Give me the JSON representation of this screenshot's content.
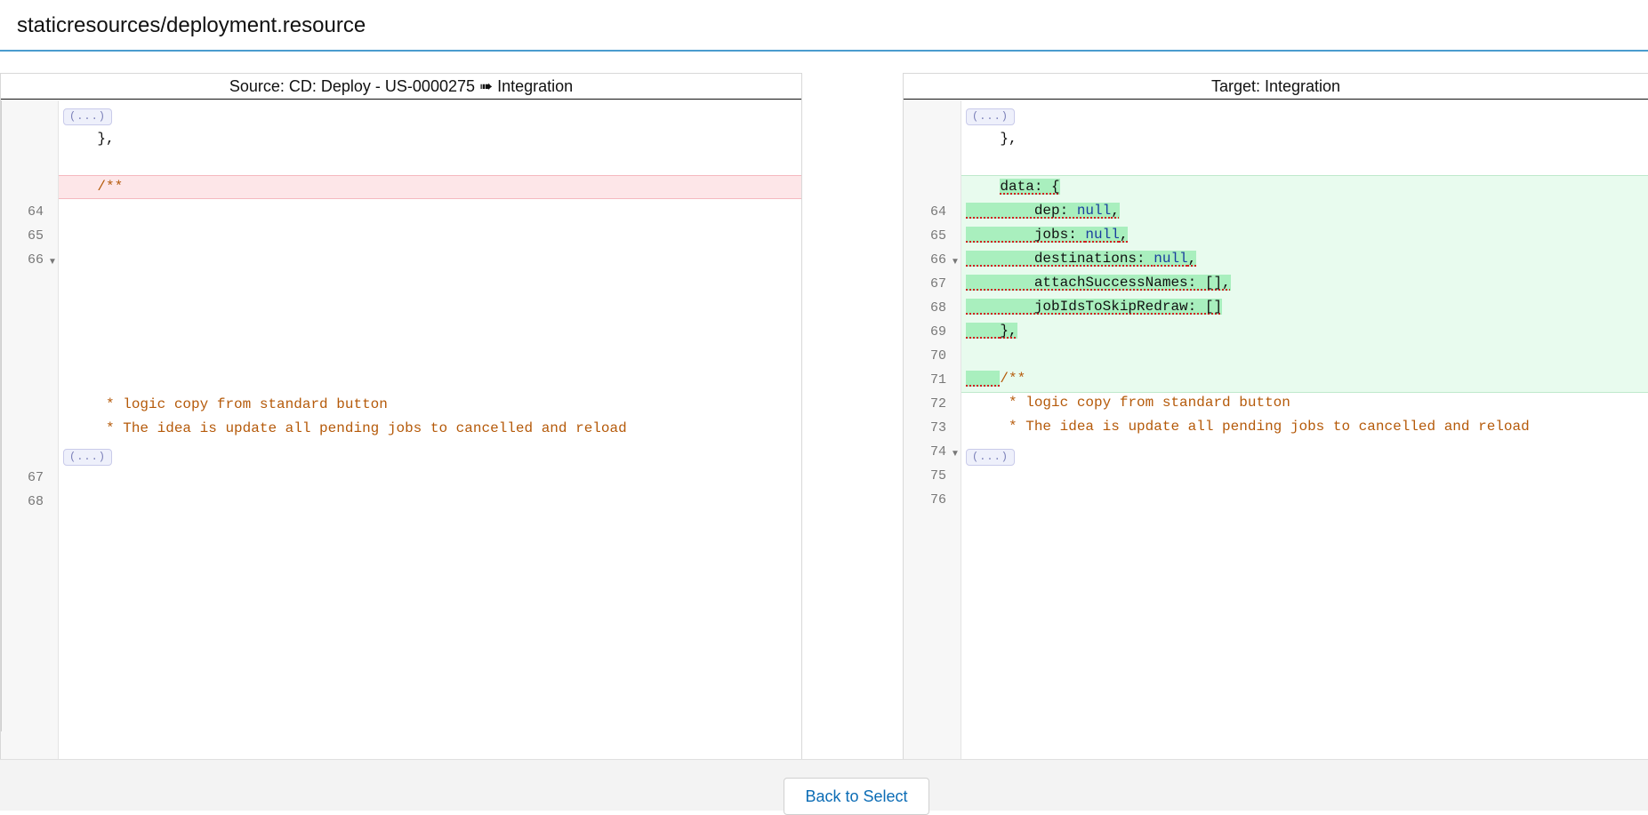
{
  "header": {
    "title": "staticresources/deployment.resource"
  },
  "source": {
    "title": "Source: CD: Deploy - US-0000275 ➠ Integration",
    "collapsed_label": "(...)",
    "lines": {
      "l64": {
        "num": "64",
        "text": "},",
        "indent": "    "
      },
      "l65": {
        "num": "65",
        "text": ""
      },
      "l66": {
        "num": "66",
        "text": "/**",
        "indent": "    "
      },
      "l67": {
        "num": "67",
        "text": "* logic copy from standard button",
        "indent": "     "
      },
      "l68": {
        "num": "68",
        "text": "* The idea is update all pending jobs to cancelled and reload",
        "indent": "     "
      }
    }
  },
  "target": {
    "title": "Target: Integration",
    "collapsed_label": "(...)",
    "lines": {
      "l64": {
        "num": "64",
        "text": "},"
      },
      "l65": {
        "num": "65",
        "text": ""
      },
      "l66": {
        "num": "66",
        "text": "data: {"
      },
      "l67": {
        "num": "67",
        "key": "dep: ",
        "value": "null",
        "tail": ","
      },
      "l68": {
        "num": "68",
        "key": "jobs: ",
        "value": "null",
        "tail": ","
      },
      "l69": {
        "num": "69",
        "key": "destinations: ",
        "value": "null",
        "tail": ","
      },
      "l70": {
        "num": "70",
        "text": "attachSuccessNames: [],"
      },
      "l71": {
        "num": "71",
        "text": "jobIdsToSkipRedraw: []"
      },
      "l72": {
        "num": "72",
        "text": "},"
      },
      "l73": {
        "num": "73",
        "text": ""
      },
      "l74": {
        "num": "74",
        "text": "/**"
      },
      "l75": {
        "num": "75",
        "text": "* logic copy from standard button"
      },
      "l76": {
        "num": "76",
        "text": "* The idea is update all pending jobs to cancelled and reload"
      }
    }
  },
  "footer": {
    "back_label": "Back to Select"
  },
  "colors": {
    "accent": "#4a9cce",
    "link": "#0b6cb5",
    "deleted_bg": "#fde6e8",
    "added_bg": "#e8fbee",
    "added_hl": "#a9efbe",
    "comment": "#b55a0a",
    "keyword": "#1a3e9e"
  }
}
